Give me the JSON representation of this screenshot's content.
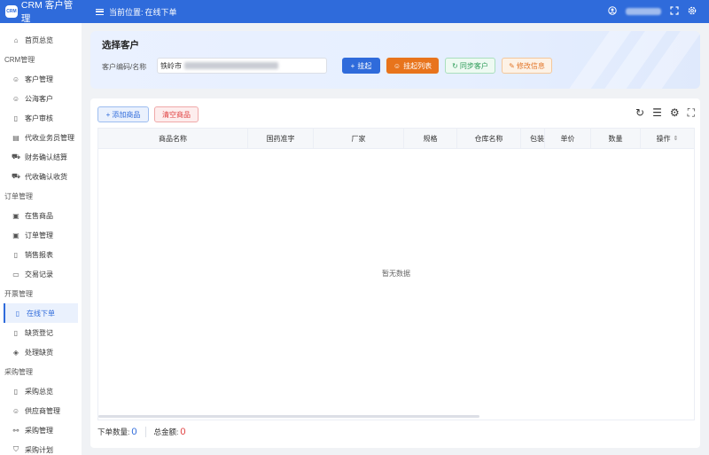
{
  "app": {
    "title": "CRM 客户管理",
    "logo_text": "CRM",
    "icon": "crm-logo-icon"
  },
  "header": {
    "breadcrumb_label": "当前位置:",
    "breadcrumb_current": "在线下单",
    "icons": [
      "user-icon",
      "fullscreen-icon",
      "settings-icon"
    ]
  },
  "sidebar": {
    "home": "首页总览",
    "groups": [
      {
        "title": "CRM管理",
        "items": [
          "客户管理",
          "公海客户",
          "客户审核",
          "代收业务员管理",
          "财务确认结算",
          "代收确认收货"
        ]
      },
      {
        "title": "订单管理",
        "items": [
          "在售商品",
          "订单管理",
          "销售报表",
          "交易记录"
        ]
      },
      {
        "title": "开票管理",
        "items": [
          "在线下单",
          "缺货登记",
          "处理缺货"
        ]
      },
      {
        "title": "采购管理",
        "items": [
          "采购总览",
          "供应商管理",
          "采购管理",
          "采购计划"
        ]
      }
    ],
    "active": "在线下单"
  },
  "select_customer": {
    "title": "选择客户",
    "field_label": "客户编码/名称",
    "field_value": "铁岭市",
    "buttons": {
      "pending": "挂起",
      "pending_list": "挂起列表",
      "sync": "同步客户",
      "edit": "修改信息"
    }
  },
  "goods": {
    "add_button": "添加商品",
    "clear_button": "清空商品",
    "columns": [
      "商品名称",
      "国药准字",
      "厂家",
      "规格",
      "仓库名称",
      "包装",
      "单价",
      "数量",
      "操作"
    ],
    "empty_text": "暂无数据"
  },
  "footer": {
    "order_count_label": "下单数量:",
    "order_count": "0",
    "total_label": "总金额:",
    "total": "0"
  }
}
